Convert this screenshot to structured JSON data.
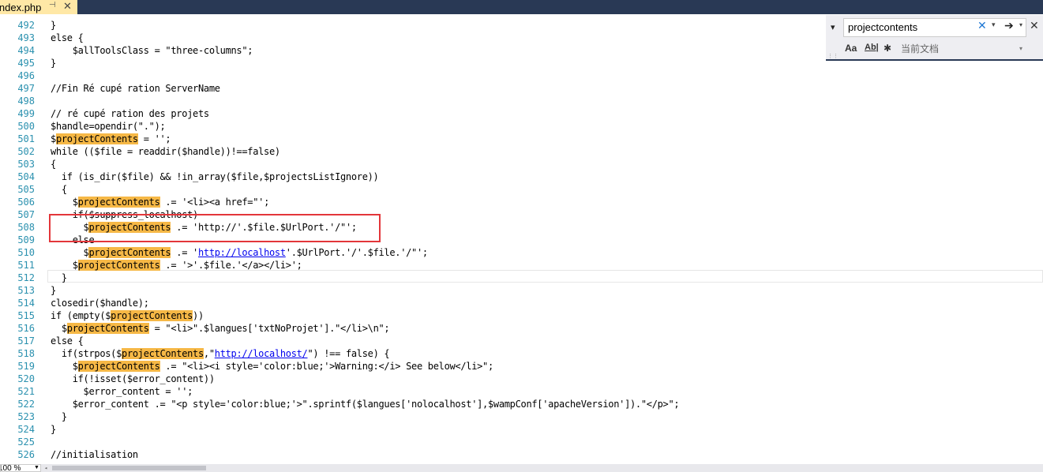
{
  "tab": {
    "filename": "index.php",
    "pin_glyph": "⊣",
    "close_glyph": "✕"
  },
  "find": {
    "query": "projectcontents",
    "clear_glyph": "✕",
    "next_glyph": "➔",
    "toggle_glyph": "▾",
    "close_glyph": "✕",
    "match_case_label": "Aa",
    "whole_word_label": "Ab|",
    "regex_label": "✱",
    "scope": "当前文档"
  },
  "zoom": {
    "value": "100 %"
  },
  "lines": [
    {
      "n": "492",
      "segs": [
        {
          "t": "}"
        }
      ]
    },
    {
      "n": "493",
      "segs": [
        {
          "t": "else {"
        }
      ]
    },
    {
      "n": "494",
      "segs": [
        {
          "t": "    $allToolsClass = \"three-columns\";"
        }
      ]
    },
    {
      "n": "495",
      "segs": [
        {
          "t": "}"
        }
      ]
    },
    {
      "n": "496",
      "segs": [
        {
          "t": ""
        }
      ]
    },
    {
      "n": "497",
      "segs": [
        {
          "t": "//Fin Ré cupé ration ServerName"
        }
      ]
    },
    {
      "n": "498",
      "segs": [
        {
          "t": ""
        }
      ]
    },
    {
      "n": "499",
      "segs": [
        {
          "t": "// ré cupé ration des projets"
        }
      ]
    },
    {
      "n": "500",
      "segs": [
        {
          "t": "$handle=opendir(\".\");"
        }
      ]
    },
    {
      "n": "501",
      "segs": [
        {
          "t": "$"
        },
        {
          "t": "projectContents",
          "h": 1
        },
        {
          "t": " = '';"
        }
      ]
    },
    {
      "n": "502",
      "segs": [
        {
          "t": "while (($file = readdir($handle))!==false)"
        }
      ]
    },
    {
      "n": "503",
      "segs": [
        {
          "t": "{"
        }
      ]
    },
    {
      "n": "504",
      "segs": [
        {
          "t": "  if (is_dir($file) && !in_array($file,$projectsListIgnore))"
        }
      ]
    },
    {
      "n": "505",
      "segs": [
        {
          "t": "  {"
        }
      ]
    },
    {
      "n": "506",
      "segs": [
        {
          "t": "    $"
        },
        {
          "t": "projectContents",
          "h": 1
        },
        {
          "t": " .= '<li><a href=\"';"
        }
      ]
    },
    {
      "n": "507",
      "segs": [
        {
          "t": "    if($suppress_localhost)"
        }
      ]
    },
    {
      "n": "508",
      "segs": [
        {
          "t": "      $"
        },
        {
          "t": "projectContents",
          "h": 1
        },
        {
          "t": " .= 'http://'.$file.$UrlPort.'/\"';"
        }
      ]
    },
    {
      "n": "509",
      "segs": [
        {
          "t": "    else"
        }
      ]
    },
    {
      "n": "510",
      "segs": [
        {
          "t": "      $"
        },
        {
          "t": "projectContents",
          "h": 1
        },
        {
          "t": " .= '"
        },
        {
          "t": "http://localhost",
          "l": 1
        },
        {
          "t": "'.$UrlPort.'/'.$file.'/\"';"
        }
      ]
    },
    {
      "n": "511",
      "segs": [
        {
          "t": "    $"
        },
        {
          "t": "projectContents",
          "h": 1
        },
        {
          "t": " .= '>'.$file.'</a></li>';"
        }
      ]
    },
    {
      "n": "512",
      "segs": [
        {
          "t": "  }"
        }
      ]
    },
    {
      "n": "513",
      "segs": [
        {
          "t": "}"
        }
      ]
    },
    {
      "n": "514",
      "segs": [
        {
          "t": "closedir($handle);"
        }
      ]
    },
    {
      "n": "515",
      "segs": [
        {
          "t": "if (empty($"
        },
        {
          "t": "projectContents",
          "h": 1
        },
        {
          "t": "))"
        }
      ]
    },
    {
      "n": "516",
      "segs": [
        {
          "t": "  $"
        },
        {
          "t": "projectContents",
          "h": 1
        },
        {
          "t": " = \"<li>\".$langues['txtNoProjet'].\"</li>\\n\";"
        }
      ]
    },
    {
      "n": "517",
      "segs": [
        {
          "t": "else {"
        }
      ]
    },
    {
      "n": "518",
      "segs": [
        {
          "t": "  if(strpos($"
        },
        {
          "t": "projectContents",
          "h": 1
        },
        {
          "t": ",\""
        },
        {
          "t": "http://localhost/",
          "l": 1
        },
        {
          "t": "\") !== false) {"
        }
      ]
    },
    {
      "n": "519",
      "segs": [
        {
          "t": "    $"
        },
        {
          "t": "projectContents",
          "h": 1
        },
        {
          "t": " .= \"<li><i style='color:blue;'>Warning:</i> See below</li>\";"
        }
      ]
    },
    {
      "n": "520",
      "segs": [
        {
          "t": "    if(!isset($error_content))"
        }
      ]
    },
    {
      "n": "521",
      "segs": [
        {
          "t": "      $error_content = '';"
        }
      ]
    },
    {
      "n": "522",
      "segs": [
        {
          "t": "    $error_content .= \"<p style='color:blue;'>\".sprintf($langues['nolocalhost'],$wampConf['apacheVersion']).\"</p>\";"
        }
      ]
    },
    {
      "n": "523",
      "segs": [
        {
          "t": "  }"
        }
      ]
    },
    {
      "n": "524",
      "segs": [
        {
          "t": "}"
        }
      ]
    },
    {
      "n": "525",
      "segs": [
        {
          "t": ""
        }
      ]
    },
    {
      "n": "526",
      "segs": [
        {
          "t": "//initialisation"
        }
      ]
    }
  ]
}
